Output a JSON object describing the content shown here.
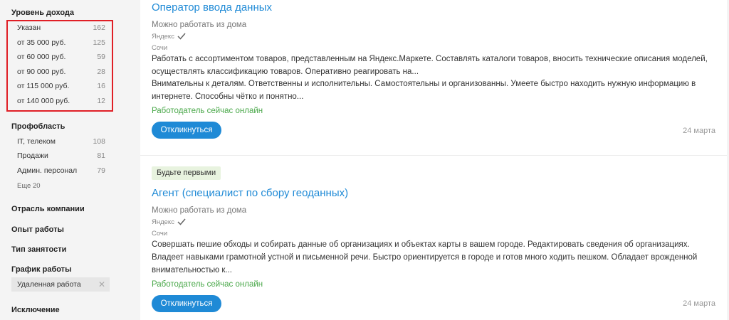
{
  "sidebar": {
    "income": {
      "title": "Уровень дохода",
      "items": [
        {
          "label": "Указан",
          "count": "162"
        },
        {
          "label": "от 35 000 руб.",
          "count": "125"
        },
        {
          "label": "от 60 000 руб.",
          "count": "59"
        },
        {
          "label": "от 90 000 руб.",
          "count": "28"
        },
        {
          "label": "от 115 000 руб.",
          "count": "16"
        },
        {
          "label": "от 140 000 руб.",
          "count": "12"
        }
      ]
    },
    "profarea": {
      "title": "Профобласть",
      "items": [
        {
          "label": "IT, телеком",
          "count": "108"
        },
        {
          "label": "Продажи",
          "count": "81"
        },
        {
          "label": "Админ. персонал",
          "count": "79"
        }
      ],
      "more": "Еще 20"
    },
    "industry": {
      "title": "Отрасль компании"
    },
    "experience": {
      "title": "Опыт работы"
    },
    "employment": {
      "title": "Тип занятости"
    },
    "schedule": {
      "title": "График работы",
      "chip": "Удаленная работа",
      "chip_remove": "✕"
    },
    "exclusion": {
      "title": "Исключение"
    }
  },
  "jobs": [
    {
      "title": "Оператор ввода данных",
      "remote": "Можно работать из дома",
      "company": "Яндекс",
      "city": "Сочи",
      "desc1": "Работать с ассортиментом товаров, представленным на Яндекс.Маркете. Составлять каталоги товаров, вносить технические описания моделей, осуществлять классификацию товаров. Оперативно реагировать на...",
      "desc2": "Внимательны к деталям. Ответственны и исполнительны. Самостоятельны и организованны. Умеете быстро находить нужную информацию в интернете. Способны чётко и понятно...",
      "online": "Работодатель сейчас онлайн",
      "button": "Откликнуться",
      "date": "24 марта"
    },
    {
      "badge": "Будьте первыми",
      "title": "Агент (специалист по сбору геоданных)",
      "remote": "Можно работать из дома",
      "company": "Яндекс",
      "city": "Сочи",
      "desc1": "Совершать пешие обходы и собирать данные об организациях и объектах карты в вашем городе. Редактировать сведения об организациях.",
      "desc2": "Владеет навыками грамотной устной и письменной речи. Быстро ориентируется в городе и готов много ходить пешком. Обладает врожденной внимательностью к...",
      "online": "Работодатель сейчас онлайн",
      "button": "Откликнуться",
      "date": "24 марта"
    }
  ],
  "colors": {
    "accent": "#1f8ad6",
    "online": "#4aa84a",
    "highlight": "#e01f26",
    "badge_bg": "#e8f3df"
  }
}
